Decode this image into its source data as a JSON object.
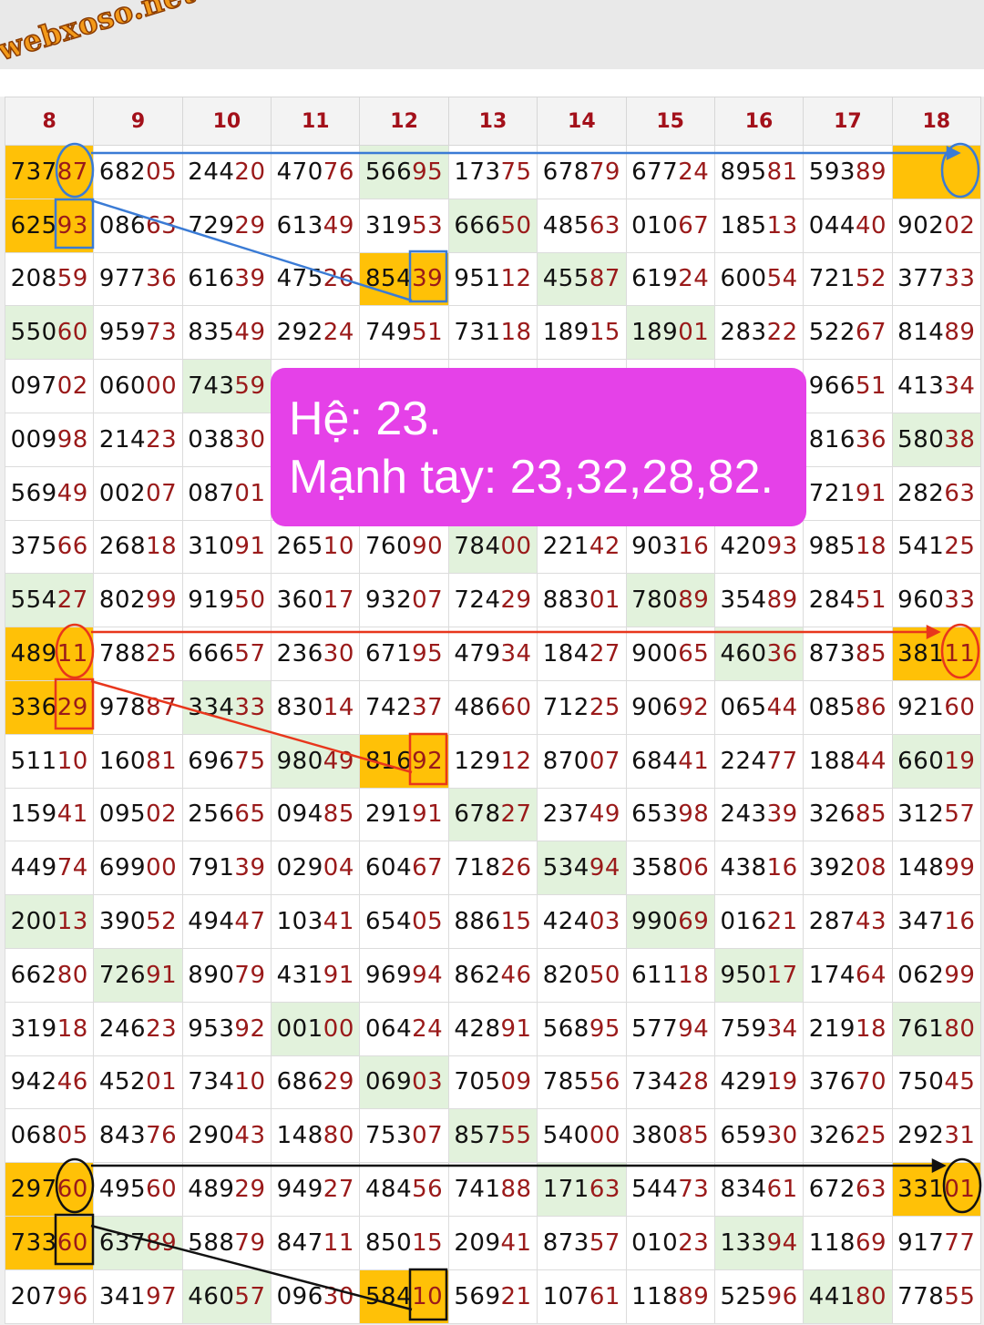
{
  "watermark": "webxoso.net",
  "note": {
    "line1": "Hệ: 23.",
    "line2": "Mạnh tay: 23,32,28,82."
  },
  "columns": [
    "8",
    "9",
    "10",
    "11",
    "12",
    "13",
    "14",
    "15",
    "16",
    "17",
    "18"
  ],
  "rows": [
    [
      "73787",
      "68205",
      "24420",
      "47076",
      "56695",
      "17375",
      "67879",
      "67724",
      "89581",
      "59389",
      ""
    ],
    [
      "62593",
      "08663",
      "72929",
      "61349",
      "31953",
      "66650",
      "48563",
      "01067",
      "18513",
      "04440",
      "90202"
    ],
    [
      "20859",
      "97736",
      "61639",
      "47526",
      "85439",
      "95112",
      "45587",
      "61924",
      "60054",
      "72152",
      "37733"
    ],
    [
      "55060",
      "95973",
      "83549",
      "29224",
      "74951",
      "73118",
      "18915",
      "18901",
      "28322",
      "52267",
      "81489"
    ],
    [
      "09702",
      "06000",
      "74359",
      "",
      "",
      "",
      "",
      "",
      "",
      "96651",
      "41334"
    ],
    [
      "00998",
      "21423",
      "03830",
      "",
      "",
      "",
      "",
      "",
      "",
      "81636",
      "58038"
    ],
    [
      "56949",
      "00207",
      "08701",
      "",
      "",
      "",
      "",
      "",
      "",
      "72191",
      "28263"
    ],
    [
      "37566",
      "26818",
      "31091",
      "26510",
      "76090",
      "78400",
      "22142",
      "90316",
      "42093",
      "98518",
      "54125"
    ],
    [
      "55427",
      "80299",
      "91950",
      "36017",
      "93207",
      "72429",
      "88301",
      "78089",
      "35489",
      "28451",
      "96033"
    ],
    [
      "48911",
      "78825",
      "66657",
      "23630",
      "67195",
      "47934",
      "18427",
      "90065",
      "46036",
      "87385",
      "38111"
    ],
    [
      "33629",
      "97887",
      "33433",
      "83014",
      "74237",
      "48660",
      "71225",
      "90692",
      "06544",
      "08586",
      "92160"
    ],
    [
      "51110",
      "16081",
      "69675",
      "98049",
      "81692",
      "12912",
      "87007",
      "68441",
      "22477",
      "18844",
      "66019"
    ],
    [
      "15941",
      "09502",
      "25665",
      "09485",
      "29191",
      "67827",
      "23749",
      "65398",
      "24339",
      "32685",
      "31257"
    ],
    [
      "44974",
      "69900",
      "79139",
      "02904",
      "60467",
      "71826",
      "53494",
      "35806",
      "43816",
      "39208",
      "14899"
    ],
    [
      "20013",
      "39052",
      "49447",
      "10341",
      "65405",
      "88615",
      "42403",
      "99069",
      "01621",
      "28743",
      "34716"
    ],
    [
      "66280",
      "72691",
      "89079",
      "43191",
      "96994",
      "86246",
      "82050",
      "61118",
      "95017",
      "17464",
      "06299"
    ],
    [
      "31918",
      "24623",
      "95392",
      "00100",
      "06424",
      "42891",
      "56895",
      "57794",
      "75934",
      "21918",
      "76180"
    ],
    [
      "94246",
      "45201",
      "73410",
      "68629",
      "06903",
      "70509",
      "78556",
      "73428",
      "42919",
      "37670",
      "75045"
    ],
    [
      "06805",
      "84376",
      "29043",
      "14880",
      "75307",
      "85755",
      "54000",
      "38085",
      "65930",
      "32625",
      "29231"
    ],
    [
      "29760",
      "49560",
      "48929",
      "94927",
      "48456",
      "74188",
      "17163",
      "54473",
      "83461",
      "67263",
      "33101"
    ],
    [
      "73360",
      "63789",
      "58879",
      "84711",
      "85015",
      "20941",
      "87357",
      "01023",
      "13394",
      "11869",
      "91777"
    ],
    [
      "20796",
      "34197",
      "46057",
      "09630",
      "58410",
      "56921",
      "10761",
      "11889",
      "52596",
      "44180",
      "77855"
    ]
  ],
  "highlights": {
    "light_green": [
      [
        0,
        4
      ],
      [
        1,
        5
      ],
      [
        2,
        6
      ],
      [
        3,
        0
      ],
      [
        3,
        7
      ],
      [
        4,
        2
      ],
      [
        5,
        10
      ],
      [
        7,
        5
      ],
      [
        8,
        0
      ],
      [
        8,
        7
      ],
      [
        9,
        8
      ],
      [
        10,
        2
      ],
      [
        11,
        3
      ],
      [
        11,
        10
      ],
      [
        12,
        5
      ],
      [
        13,
        6
      ],
      [
        14,
        0
      ],
      [
        14,
        7
      ],
      [
        15,
        1
      ],
      [
        15,
        8
      ],
      [
        16,
        3
      ],
      [
        16,
        10
      ],
      [
        17,
        4
      ],
      [
        18,
        5
      ],
      [
        19,
        6
      ],
      [
        20,
        1
      ],
      [
        20,
        8
      ],
      [
        21,
        2
      ],
      [
        21,
        9
      ]
    ],
    "orange": [
      [
        0,
        0
      ],
      [
        0,
        10
      ],
      [
        1,
        0
      ],
      [
        2,
        4
      ],
      [
        9,
        0
      ],
      [
        9,
        10
      ],
      [
        10,
        0
      ],
      [
        11,
        4
      ],
      [
        19,
        0
      ],
      [
        19,
        10
      ],
      [
        20,
        0
      ],
      [
        21,
        4
      ]
    ]
  },
  "colors": {
    "orange_cell": "#ffc107",
    "green_cell": "#e2f2dc",
    "prefix_text": "#111111",
    "suffix_text": "#9a1a1a",
    "header_text": "#a3101a",
    "note_bg": "#e541e8",
    "arrow_group_1": "#3a7bd5",
    "arrow_group_2": "#e8361c",
    "arrow_group_3": "#111111"
  }
}
